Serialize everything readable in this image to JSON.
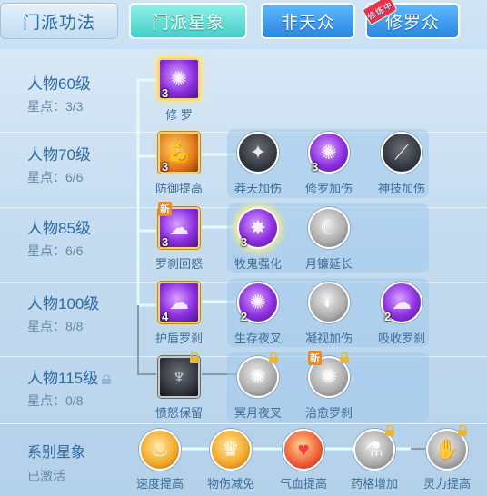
{
  "tabs": [
    {
      "label": "门派功法",
      "style": "flat"
    },
    {
      "label": "门派星象",
      "style": "active"
    },
    {
      "label": "非天众",
      "style": "blue"
    },
    {
      "label": "修罗众",
      "style": "blue",
      "badge": "修炼中"
    }
  ],
  "tiers": [
    {
      "name": "人物60级",
      "stars": "星点：3/3"
    },
    {
      "name": "人物70级",
      "stars": "星点：6/6"
    },
    {
      "name": "人物85级",
      "stars": "星点：6/6"
    },
    {
      "name": "人物100级",
      "stars": "星点：8/8"
    },
    {
      "name": "人物115级",
      "stars": "星点：0/8"
    }
  ],
  "skills": {
    "t60": [
      {
        "name": "修 罗",
        "level": "3"
      }
    ],
    "t70": [
      {
        "name": "防御提高",
        "level": "3"
      },
      {
        "name": "莽天加伤",
        "level": ""
      },
      {
        "name": "修罗加伤",
        "level": "3"
      },
      {
        "name": "神技加伤",
        "level": ""
      }
    ],
    "t85": [
      {
        "name": "罗刹回怒",
        "level": "3",
        "badge": "新"
      },
      {
        "name": "牧鬼强化",
        "level": "3"
      },
      {
        "name": "月镰延长",
        "level": ""
      }
    ],
    "t100": [
      {
        "name": "护盾罗刹",
        "level": "4"
      },
      {
        "name": "生存夜叉",
        "level": "2"
      },
      {
        "name": "凝视加伤",
        "level": ""
      },
      {
        "name": "吸收罗刹",
        "level": "2"
      }
    ],
    "t115": [
      {
        "name": "愤怒保留",
        "level": ""
      },
      {
        "name": "冥月夜叉",
        "level": ""
      },
      {
        "name": "治愈罗刹",
        "level": "",
        "badge": "新"
      }
    ]
  },
  "series": {
    "title": "系别星象",
    "status": "已激活",
    "items": [
      {
        "name": "速度提高"
      },
      {
        "name": "物伤减免"
      },
      {
        "name": "气血提高"
      },
      {
        "name": "药格增加"
      },
      {
        "name": "灵力提高"
      }
    ]
  },
  "colors": {
    "accent": "#43cfc8",
    "tab_blue": "#2a86e0",
    "label": "#2c6aa6"
  }
}
